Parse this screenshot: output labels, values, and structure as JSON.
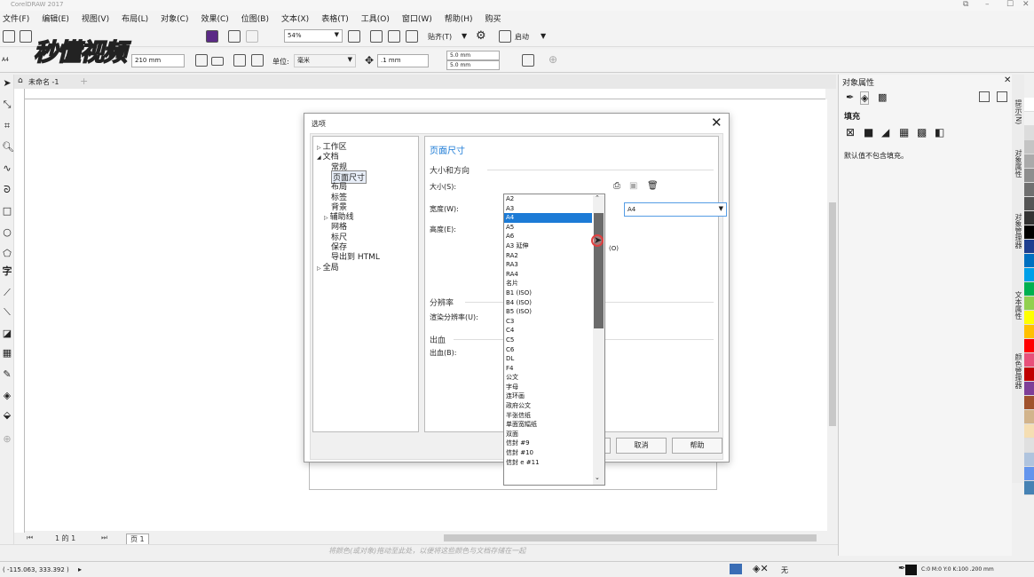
{
  "app": {
    "title": "CorelDRAW 2017"
  },
  "menu": [
    "文件(F)",
    "编辑(E)",
    "视图(V)",
    "布局(L)",
    "对象(C)",
    "效果(C)",
    "位图(B)",
    "文本(X)",
    "表格(T)",
    "工具(O)",
    "窗口(W)",
    "帮助(H)",
    "购买"
  ],
  "toolbar": {
    "zoom": "54%",
    "snap": "贴齐(T)",
    "launch": "启动"
  },
  "propbar": {
    "page_size": "A4",
    "width": "210 mm",
    "unit_label": "单位:",
    "unit": "毫米",
    "nudge": ".1 mm",
    "dup_x": "5.0 mm",
    "dup_y": "5.0 mm"
  },
  "watermark": "秒懂视频",
  "doc_tab": "未命名 -1",
  "page_nav": {
    "text": "1 的 1",
    "page_tab": "页 1"
  },
  "hint": "将颜色(或对象)拖动至此处，以便将这些颜色与文档存储在一起",
  "status": {
    "coords": "( -115.063, 333.392 )",
    "fill": "无",
    "outline": "C:0 M:0 Y:0 K:100 .200 mm"
  },
  "docker": {
    "title": "对象属性",
    "fill_label": "填充",
    "fill_msg": "默认值不包含填充。",
    "tabs": [
      "提示(N)",
      "对象属性",
      "对象管理器",
      "文本属性",
      "颜色管理器"
    ]
  },
  "palette": [
    "#ffffff",
    "#f2f2f2",
    "#dcdcdc",
    "#c4c4c4",
    "#aaaaaa",
    "#8e8e8e",
    "#707070",
    "#555555",
    "#333333",
    "#000000",
    "#1f3f8f",
    "#0070c0",
    "#00a0e9",
    "#00b050",
    "#92d050",
    "#ffff00",
    "#ffc000",
    "#ff0000",
    "#e8507a",
    "#c00000",
    "#7f3f98",
    "#a0522d",
    "#d2b48c",
    "#f5deb3",
    "#e0e0e0",
    "#b0c4de",
    "#6495ed",
    "#4682b4"
  ],
  "dialog": {
    "title": "选项",
    "tree": [
      {
        "label": "工作区",
        "level": 0,
        "arrow": "▷"
      },
      {
        "label": "文档",
        "level": 0,
        "arrow": "◢"
      },
      {
        "label": "常规",
        "level": 1
      },
      {
        "label": "页面尺寸",
        "level": 1,
        "selected": true
      },
      {
        "label": "布局",
        "level": 1
      },
      {
        "label": "标签",
        "level": 1
      },
      {
        "label": "背景",
        "level": 1
      },
      {
        "label": "辅助线",
        "level": 1,
        "arrow": "▷"
      },
      {
        "label": "网格",
        "level": 1
      },
      {
        "label": "标尺",
        "level": 1
      },
      {
        "label": "保存",
        "level": 1
      },
      {
        "label": "导出到 HTML",
        "level": 1
      },
      {
        "label": "全局",
        "level": 0,
        "arrow": "▷"
      }
    ],
    "panel_title": "页面尺寸",
    "section_size": "大小和方向",
    "size_label": "大小(S):",
    "size_value": "A4",
    "width_label": "宽度(W):",
    "height_label": "高度(E):",
    "partial_label": "(O)",
    "section_res": "分辨率",
    "res_label": "渲染分辨率(U):",
    "section_bleed": "出血",
    "bleed_label": "出血(B):",
    "cancel": "取消",
    "help": "帮助",
    "size_options": [
      "A2",
      "A3",
      "A4",
      "A5",
      "A6",
      "A3 延伸",
      "RA2",
      "RA3",
      "RA4",
      "名片",
      "B1 (ISO)",
      "B4 (ISO)",
      "B5 (ISO)",
      "C3",
      "C4",
      "C5",
      "C6",
      "DL",
      "F4",
      "公文",
      "字母",
      "连环画",
      "政府公文",
      "半张信纸",
      "单面宽幅纸",
      "双面",
      "信封 #9",
      "信封 #10",
      "信封 e #11"
    ],
    "selected_option": "A4"
  }
}
